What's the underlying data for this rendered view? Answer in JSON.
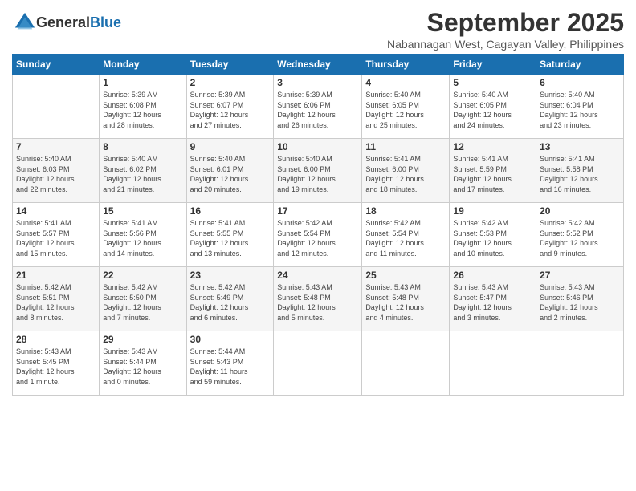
{
  "logo": {
    "general": "General",
    "blue": "Blue"
  },
  "title": "September 2025",
  "subtitle": "Nabannagan West, Cagayan Valley, Philippines",
  "weekdays": [
    "Sunday",
    "Monday",
    "Tuesday",
    "Wednesday",
    "Thursday",
    "Friday",
    "Saturday"
  ],
  "weeks": [
    [
      {
        "day": "",
        "detail": ""
      },
      {
        "day": "1",
        "detail": "Sunrise: 5:39 AM\nSunset: 6:08 PM\nDaylight: 12 hours\nand 28 minutes."
      },
      {
        "day": "2",
        "detail": "Sunrise: 5:39 AM\nSunset: 6:07 PM\nDaylight: 12 hours\nand 27 minutes."
      },
      {
        "day": "3",
        "detail": "Sunrise: 5:39 AM\nSunset: 6:06 PM\nDaylight: 12 hours\nand 26 minutes."
      },
      {
        "day": "4",
        "detail": "Sunrise: 5:40 AM\nSunset: 6:05 PM\nDaylight: 12 hours\nand 25 minutes."
      },
      {
        "day": "5",
        "detail": "Sunrise: 5:40 AM\nSunset: 6:05 PM\nDaylight: 12 hours\nand 24 minutes."
      },
      {
        "day": "6",
        "detail": "Sunrise: 5:40 AM\nSunset: 6:04 PM\nDaylight: 12 hours\nand 23 minutes."
      }
    ],
    [
      {
        "day": "7",
        "detail": "Sunrise: 5:40 AM\nSunset: 6:03 PM\nDaylight: 12 hours\nand 22 minutes."
      },
      {
        "day": "8",
        "detail": "Sunrise: 5:40 AM\nSunset: 6:02 PM\nDaylight: 12 hours\nand 21 minutes."
      },
      {
        "day": "9",
        "detail": "Sunrise: 5:40 AM\nSunset: 6:01 PM\nDaylight: 12 hours\nand 20 minutes."
      },
      {
        "day": "10",
        "detail": "Sunrise: 5:40 AM\nSunset: 6:00 PM\nDaylight: 12 hours\nand 19 minutes."
      },
      {
        "day": "11",
        "detail": "Sunrise: 5:41 AM\nSunset: 6:00 PM\nDaylight: 12 hours\nand 18 minutes."
      },
      {
        "day": "12",
        "detail": "Sunrise: 5:41 AM\nSunset: 5:59 PM\nDaylight: 12 hours\nand 17 minutes."
      },
      {
        "day": "13",
        "detail": "Sunrise: 5:41 AM\nSunset: 5:58 PM\nDaylight: 12 hours\nand 16 minutes."
      }
    ],
    [
      {
        "day": "14",
        "detail": "Sunrise: 5:41 AM\nSunset: 5:57 PM\nDaylight: 12 hours\nand 15 minutes."
      },
      {
        "day": "15",
        "detail": "Sunrise: 5:41 AM\nSunset: 5:56 PM\nDaylight: 12 hours\nand 14 minutes."
      },
      {
        "day": "16",
        "detail": "Sunrise: 5:41 AM\nSunset: 5:55 PM\nDaylight: 12 hours\nand 13 minutes."
      },
      {
        "day": "17",
        "detail": "Sunrise: 5:42 AM\nSunset: 5:54 PM\nDaylight: 12 hours\nand 12 minutes."
      },
      {
        "day": "18",
        "detail": "Sunrise: 5:42 AM\nSunset: 5:54 PM\nDaylight: 12 hours\nand 11 minutes."
      },
      {
        "day": "19",
        "detail": "Sunrise: 5:42 AM\nSunset: 5:53 PM\nDaylight: 12 hours\nand 10 minutes."
      },
      {
        "day": "20",
        "detail": "Sunrise: 5:42 AM\nSunset: 5:52 PM\nDaylight: 12 hours\nand 9 minutes."
      }
    ],
    [
      {
        "day": "21",
        "detail": "Sunrise: 5:42 AM\nSunset: 5:51 PM\nDaylight: 12 hours\nand 8 minutes."
      },
      {
        "day": "22",
        "detail": "Sunrise: 5:42 AM\nSunset: 5:50 PM\nDaylight: 12 hours\nand 7 minutes."
      },
      {
        "day": "23",
        "detail": "Sunrise: 5:42 AM\nSunset: 5:49 PM\nDaylight: 12 hours\nand 6 minutes."
      },
      {
        "day": "24",
        "detail": "Sunrise: 5:43 AM\nSunset: 5:48 PM\nDaylight: 12 hours\nand 5 minutes."
      },
      {
        "day": "25",
        "detail": "Sunrise: 5:43 AM\nSunset: 5:48 PM\nDaylight: 12 hours\nand 4 minutes."
      },
      {
        "day": "26",
        "detail": "Sunrise: 5:43 AM\nSunset: 5:47 PM\nDaylight: 12 hours\nand 3 minutes."
      },
      {
        "day": "27",
        "detail": "Sunrise: 5:43 AM\nSunset: 5:46 PM\nDaylight: 12 hours\nand 2 minutes."
      }
    ],
    [
      {
        "day": "28",
        "detail": "Sunrise: 5:43 AM\nSunset: 5:45 PM\nDaylight: 12 hours\nand 1 minute."
      },
      {
        "day": "29",
        "detail": "Sunrise: 5:43 AM\nSunset: 5:44 PM\nDaylight: 12 hours\nand 0 minutes."
      },
      {
        "day": "30",
        "detail": "Sunrise: 5:44 AM\nSunset: 5:43 PM\nDaylight: 11 hours\nand 59 minutes."
      },
      {
        "day": "",
        "detail": ""
      },
      {
        "day": "",
        "detail": ""
      },
      {
        "day": "",
        "detail": ""
      },
      {
        "day": "",
        "detail": ""
      }
    ]
  ]
}
